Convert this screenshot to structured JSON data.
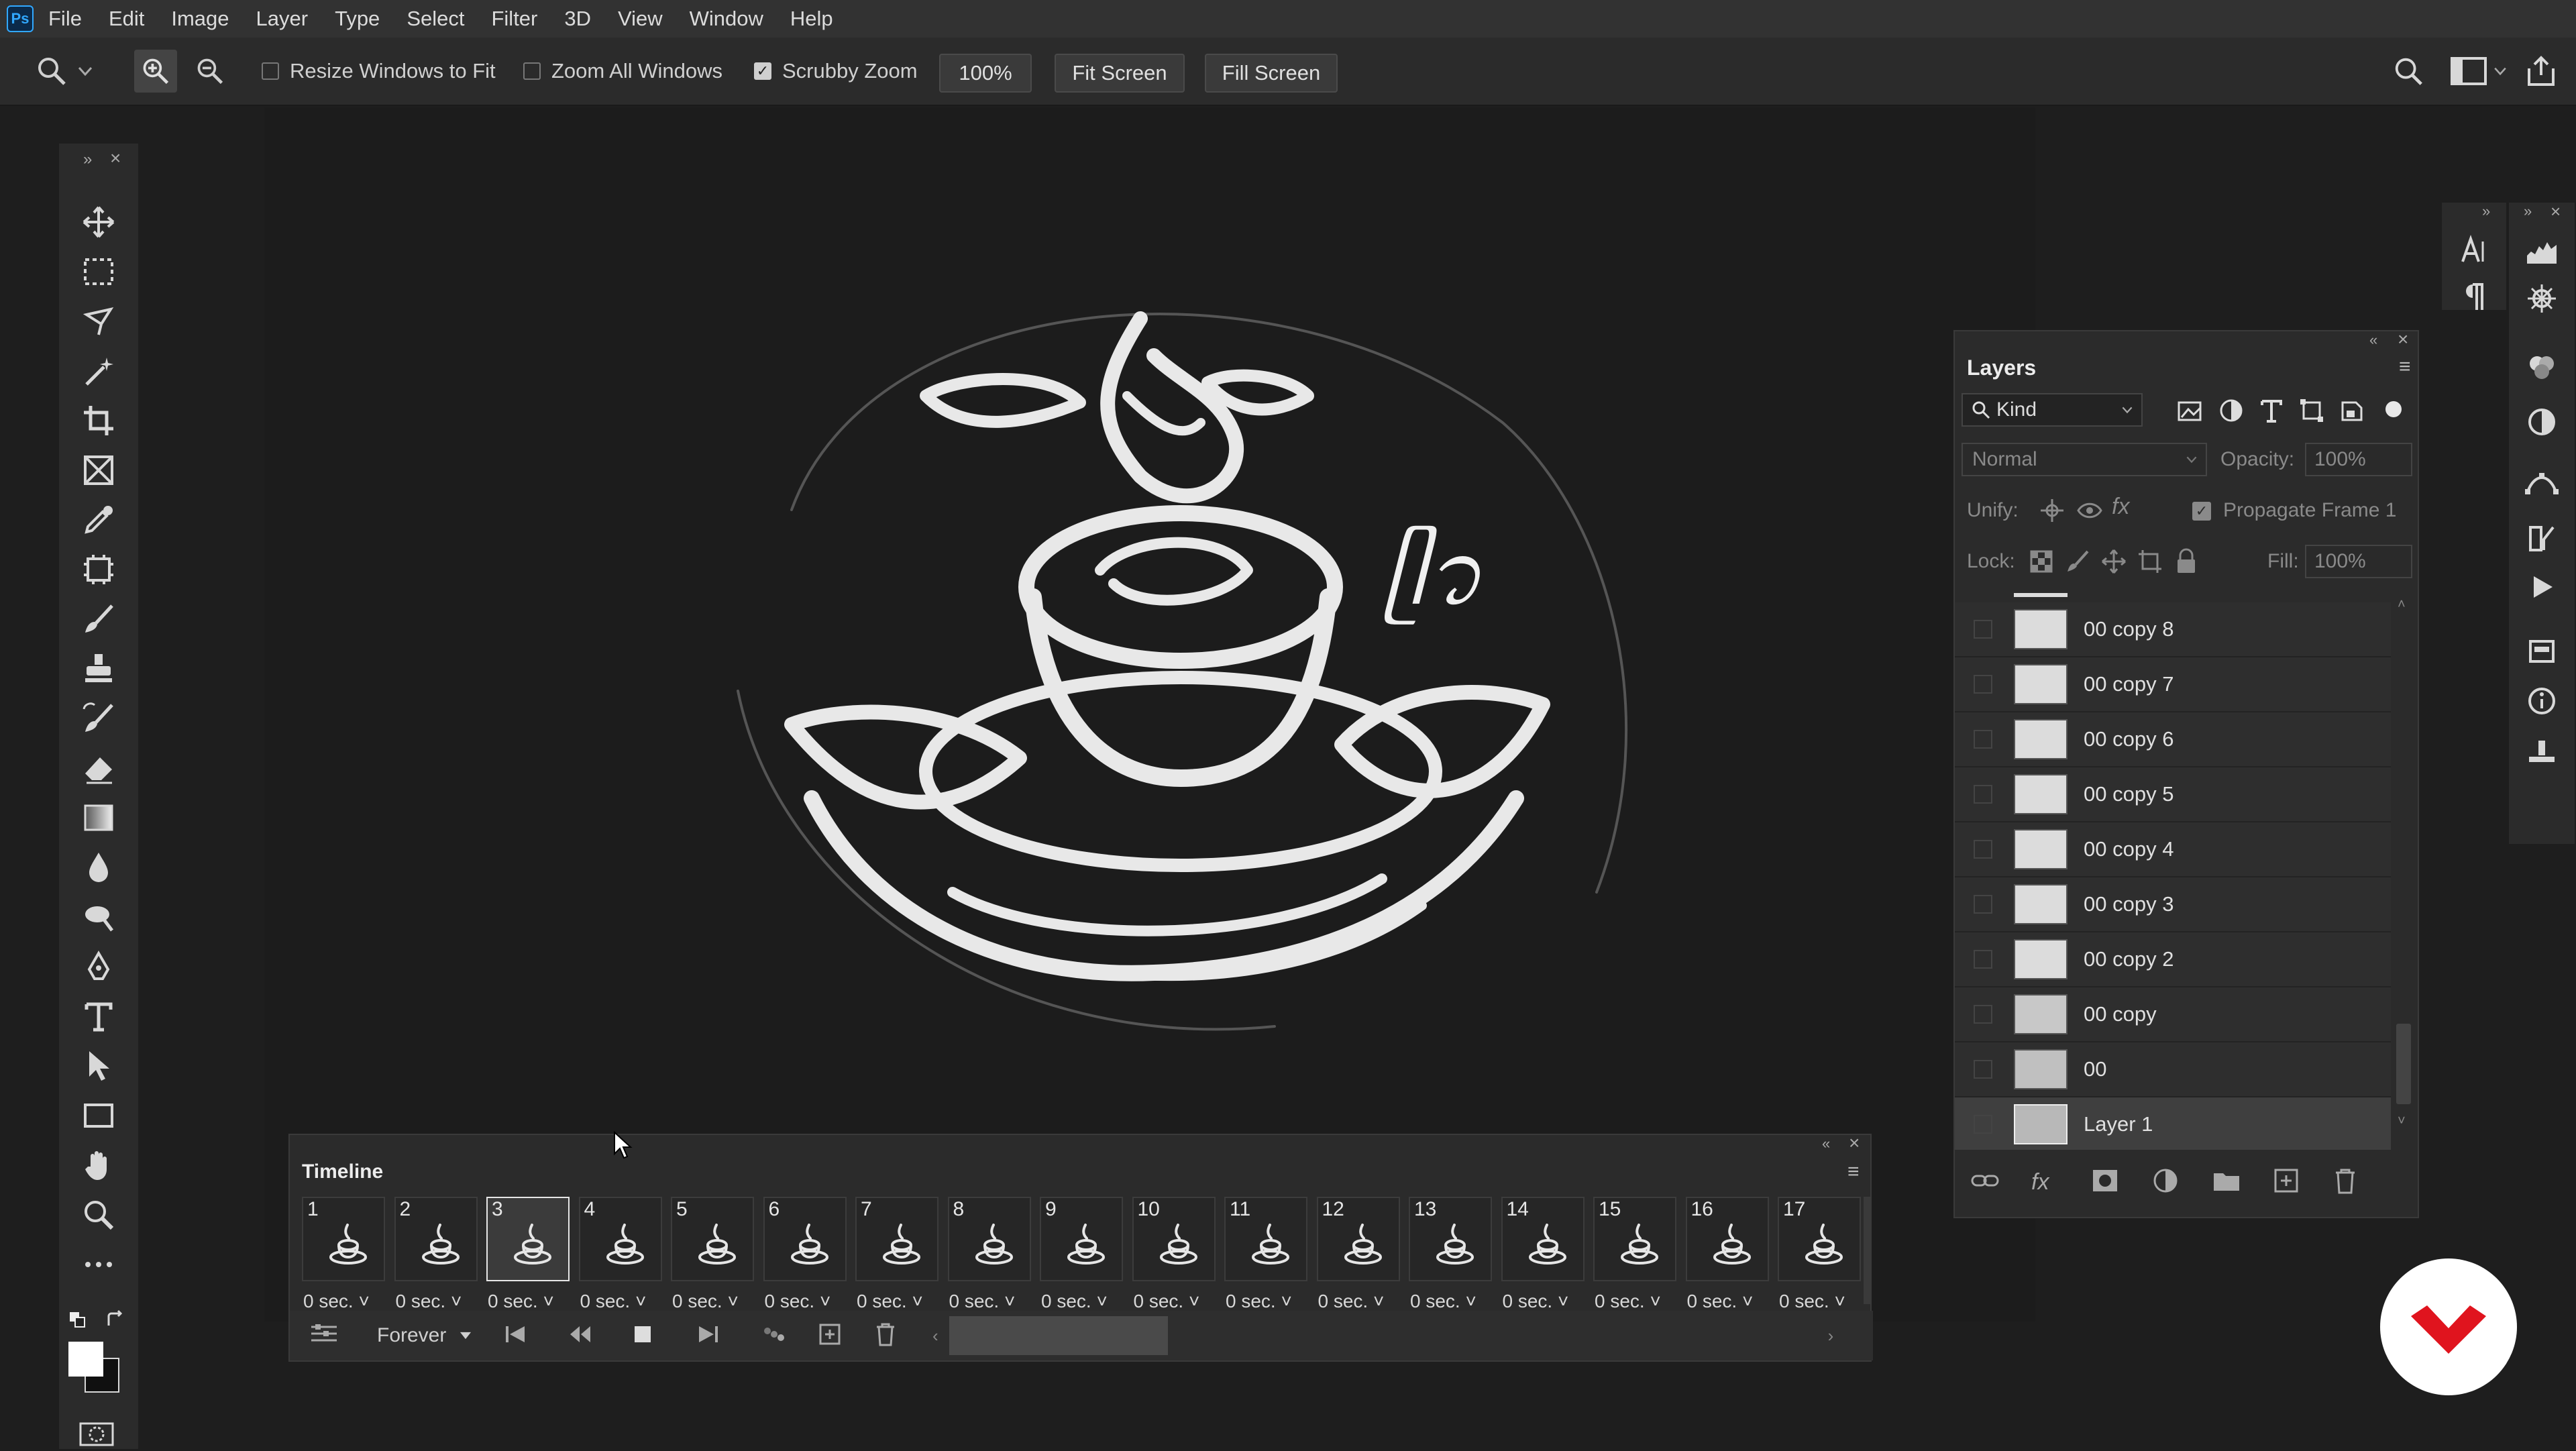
{
  "app": {
    "logo": "Ps"
  },
  "menubar": {
    "items": [
      "File",
      "Edit",
      "Image",
      "Layer",
      "Type",
      "Select",
      "Filter",
      "3D",
      "View",
      "Window",
      "Help"
    ]
  },
  "options": {
    "resize_windows": {
      "label": "Resize Windows to Fit",
      "checked": false
    },
    "zoom_all": {
      "label": "Zoom All Windows",
      "checked": false
    },
    "scrubby_zoom": {
      "label": "Scrubby Zoom",
      "checked": true
    },
    "zoom_value": "100%",
    "fit_screen": "Fit Screen",
    "fill_screen": "Fill Screen"
  },
  "tools": [
    "move-tool",
    "marquee-tool",
    "lasso-tool",
    "magic-wand-tool",
    "crop-tool",
    "frame-tool",
    "eyedropper-tool",
    "patch-tool",
    "brush-tool",
    "stamp-tool",
    "history-brush-tool",
    "eraser-tool",
    "gradient-tool",
    "blur-tool",
    "dodge-tool",
    "pen-tool",
    "type-tool",
    "path-select-tool",
    "rectangle-tool",
    "hand-tool",
    "zoom-tool",
    "more-tools"
  ],
  "canvas": {
    "overlay_text": "ᥫ᭡"
  },
  "layers": {
    "title": "Layers",
    "filter_kind": "Kind",
    "blend_mode": "Normal",
    "opacity_label": "Opacity:",
    "opacity_value": "100%",
    "unify_label": "Unify:",
    "propagate_label": "Propagate Frame 1",
    "lock_label": "Lock:",
    "fill_label": "Fill:",
    "fill_value": "100%",
    "items": [
      "00 copy 8",
      "00 copy 7",
      "00 copy 6",
      "00 copy 5",
      "00 copy 4",
      "00 copy 3",
      "00 copy 2",
      "00 copy",
      "00",
      "Layer 1"
    ]
  },
  "timeline": {
    "title": "Timeline",
    "loop": "Forever",
    "frames": [
      {
        "num": "1",
        "delay": "0 sec."
      },
      {
        "num": "2",
        "delay": "0 sec."
      },
      {
        "num": "3",
        "delay": "0 sec."
      },
      {
        "num": "4",
        "delay": "0 sec."
      },
      {
        "num": "5",
        "delay": "0 sec."
      },
      {
        "num": "6",
        "delay": "0 sec."
      },
      {
        "num": "7",
        "delay": "0 sec."
      },
      {
        "num": "8",
        "delay": "0 sec."
      },
      {
        "num": "9",
        "delay": "0 sec."
      },
      {
        "num": "10",
        "delay": "0 sec."
      },
      {
        "num": "11",
        "delay": "0 sec."
      },
      {
        "num": "12",
        "delay": "0 sec."
      },
      {
        "num": "13",
        "delay": "0 sec."
      },
      {
        "num": "14",
        "delay": "0 sec."
      },
      {
        "num": "15",
        "delay": "0 sec."
      },
      {
        "num": "16",
        "delay": "0 sec."
      },
      {
        "num": "17",
        "delay": "0 sec."
      }
    ],
    "selected_frame": "3"
  },
  "colors": {
    "accent": "#31a8ff",
    "panel": "#2b2b2b",
    "canvas_bg": "#1c1c1c",
    "badge_red": "#e0141e"
  }
}
